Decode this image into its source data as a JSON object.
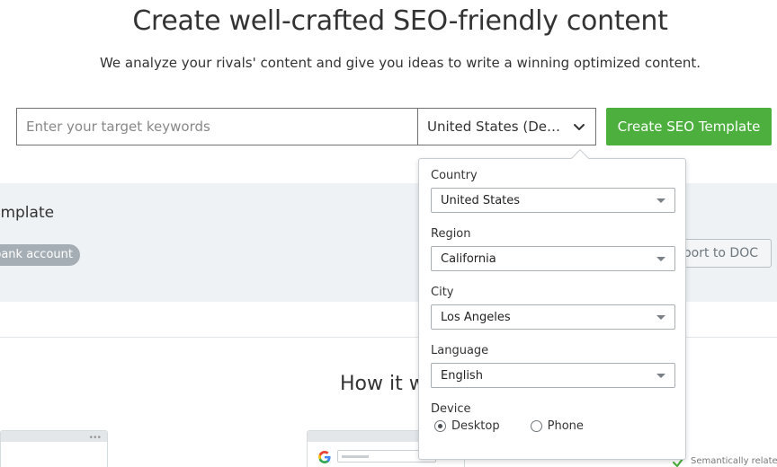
{
  "hero": {
    "title": "Create well-crafted SEO-friendly content",
    "subtitle": "We analyze your rivals' content and give you ideas to write a winning optimized content."
  },
  "search": {
    "keyword_placeholder": "Enter your target keywords",
    "location_selected": "United States (Des…",
    "create_button": "Create SEO Template"
  },
  "template_band": {
    "title_partial": "emplate",
    "tag_partial": "bank account",
    "export_partial": "xport to DOC"
  },
  "how_it_works": {
    "heading_partial": "How it w"
  },
  "preview_cards": {
    "right_label_partial": "Semantically related"
  },
  "location_dropdown": {
    "country_label": "Country",
    "country_value": "United States",
    "region_label": "Region",
    "region_value": "California",
    "city_label": "City",
    "city_value": "Los Angeles",
    "language_label": "Language",
    "language_value": "English",
    "device_label": "Device",
    "device_options": [
      "Desktop",
      "Phone"
    ],
    "device_selected": "Desktop"
  },
  "colors": {
    "accent_green": "#4caf3e",
    "band_background": "#eef2f5",
    "tag_gray": "#a5aeb4"
  }
}
